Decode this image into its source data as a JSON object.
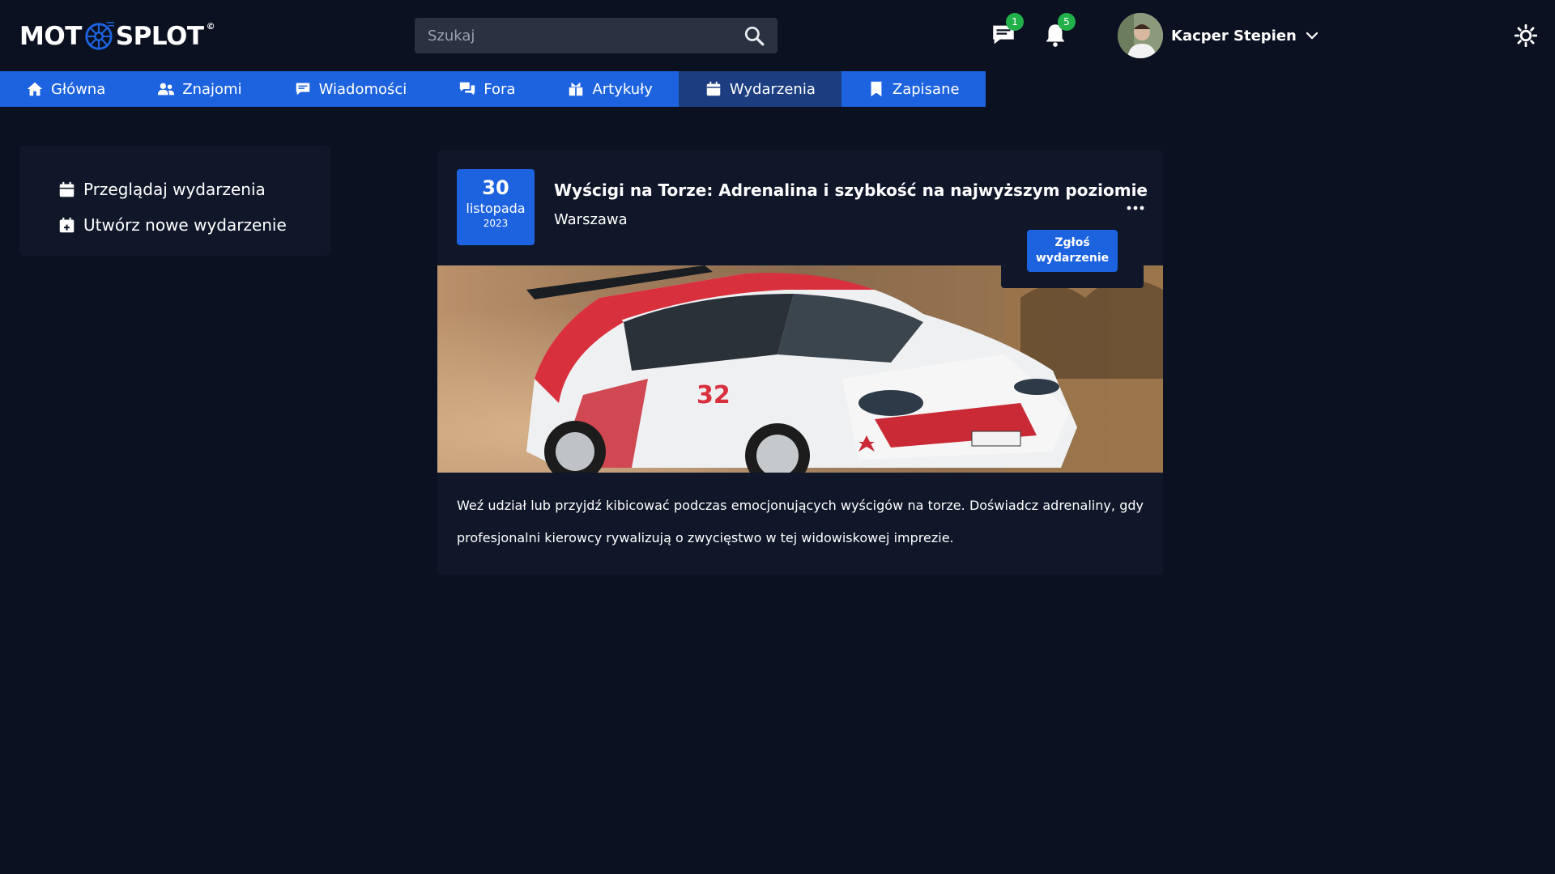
{
  "header": {
    "logo_text_left": "MOT",
    "logo_text_right": "SPLOT",
    "logo_mark": "©",
    "search_placeholder": "Szukaj",
    "messages_count": "1",
    "notifications_count": "5",
    "user_name": "Kacper Stepien"
  },
  "nav": {
    "items": [
      {
        "label": "Główna",
        "icon": "home-icon"
      },
      {
        "label": "Znajomi",
        "icon": "users-icon"
      },
      {
        "label": "Wiadomości",
        "icon": "message-icon"
      },
      {
        "label": "Fora",
        "icon": "forum-icon"
      },
      {
        "label": "Artykuły",
        "icon": "articles-icon"
      },
      {
        "label": "Wydarzenia",
        "icon": "calendar-icon"
      },
      {
        "label": "Zapisane",
        "icon": "bookmark-icon"
      }
    ],
    "active": "Wydarzenia"
  },
  "sidebar": {
    "items": [
      {
        "label": "Przeglądaj wydarzenia",
        "icon": "calendar-icon"
      },
      {
        "label": "Utwórz nowe wydarzenie",
        "icon": "calendar-plus-icon"
      }
    ]
  },
  "event": {
    "day": "30",
    "month": "listopada",
    "year": "2023",
    "title": "Wyścigi na Torze: Adrenalina i szybkość na najwyższym poziomie",
    "location": "Warszawa",
    "report_label_1": "Zgłoś",
    "report_label_2": "wydarzenie",
    "description": "Weź udział lub przyjdź kibicować podczas emocjonujących wyścigów na torze. Doświadcz adrenaliny, gdy profesjonalni kierowcy rywalizują o zwycięstwo w tej widowiskowej imprezie."
  },
  "colors": {
    "background": "#0b1120",
    "card": "#0f1729",
    "accent": "#1d63e0",
    "nav_active": "#1c3d80",
    "badge": "#22b04b",
    "search_bg": "#2a3140"
  }
}
